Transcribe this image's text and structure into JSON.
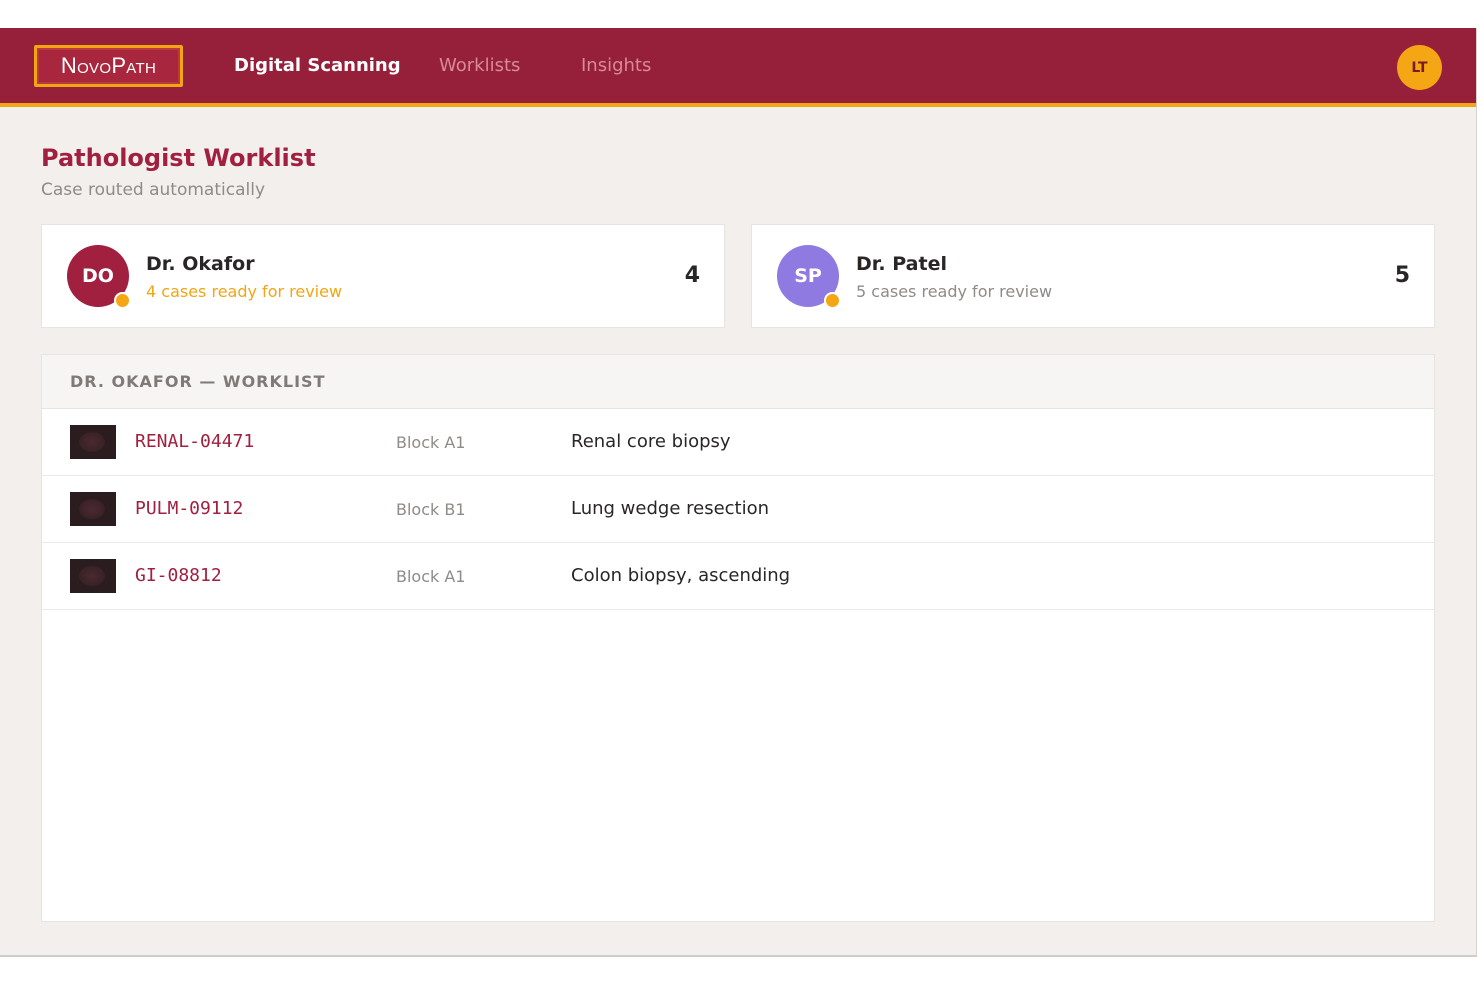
{
  "app": {
    "logo": "NovoPath",
    "nav": [
      {
        "label": "Digital Scanning",
        "active": true
      },
      {
        "label": "Worklists",
        "active": false
      },
      {
        "label": "Insights",
        "active": false
      }
    ],
    "user_initials": "LT"
  },
  "colors": {
    "brand": "#96203a",
    "accent": "#f2a515",
    "okafor_avatar": "#a11f3f",
    "patel_avatar": "#8e7ae0"
  },
  "page": {
    "title": "Pathologist Worklist",
    "subtitle": "Case routed automatically"
  },
  "pathologists": [
    {
      "initials": "DO",
      "name": "Dr. Okafor",
      "status": "4 cases ready for review",
      "count": "4",
      "highlighted": true
    },
    {
      "initials": "SP",
      "name": "Dr. Patel",
      "status": "5 cases ready for review",
      "count": "5",
      "highlighted": false
    }
  ],
  "worklist": {
    "header": "DR. OKAFOR — WORKLIST",
    "rows": [
      {
        "case_id": "RENAL-04471",
        "block": "Block A1",
        "description": "Renal core biopsy"
      },
      {
        "case_id": "PULM-09112",
        "block": "Block B1",
        "description": "Lung wedge resection"
      },
      {
        "case_id": "GI-08812",
        "block": "Block A1",
        "description": "Colon biopsy, ascending"
      }
    ]
  }
}
